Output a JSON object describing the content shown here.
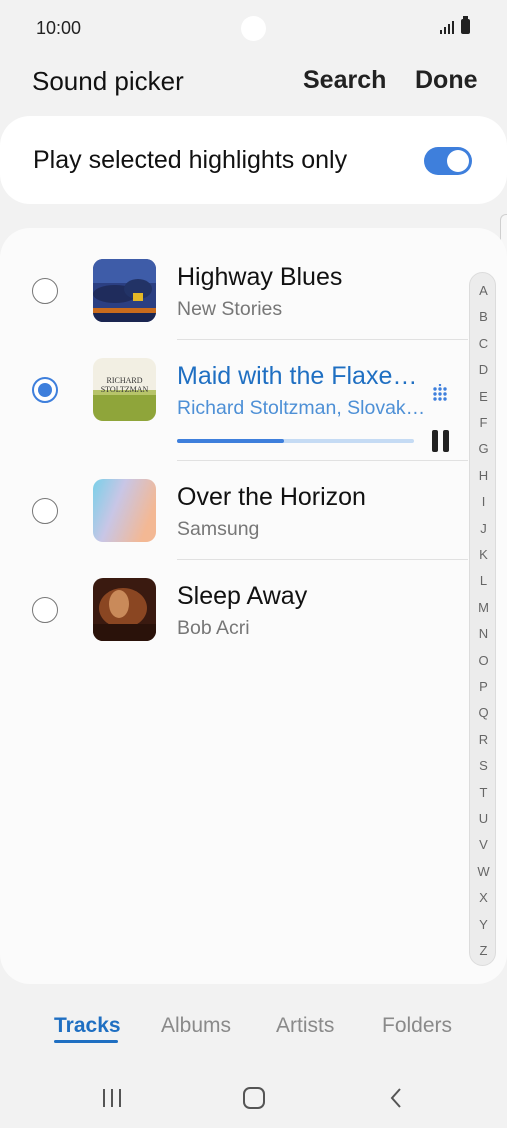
{
  "status_bar": {
    "time": "10:00"
  },
  "header": {
    "title": "Sound picker",
    "search_label": "Search",
    "done_label": "Done"
  },
  "highlights": {
    "label": "Play selected highlights only",
    "enabled": true
  },
  "tracks": [
    {
      "title": "Highway Blues",
      "artist": "New Stories",
      "selected": false
    },
    {
      "title": "Maid with the Flaxe…",
      "artist": "Richard Stoltzman, Slovak…",
      "selected": true,
      "playing": true,
      "progress": 0.45
    },
    {
      "title": "Over the Horizon",
      "artist": "Samsung",
      "selected": false
    },
    {
      "title": "Sleep Away",
      "artist": "Bob Acri",
      "selected": false
    }
  ],
  "album_art_text": {
    "track_2_line1": "RICHARD",
    "track_2_line2": "STOLTZMAN"
  },
  "alphabet_index": [
    "A",
    "B",
    "C",
    "D",
    "E",
    "F",
    "G",
    "H",
    "I",
    "J",
    "K",
    "L",
    "M",
    "N",
    "O",
    "P",
    "Q",
    "R",
    "S",
    "T",
    "U",
    "V",
    "W",
    "X",
    "Y",
    "Z"
  ],
  "tabs": [
    {
      "label": "Tracks",
      "active": true
    },
    {
      "label": "Albums",
      "active": false
    },
    {
      "label": "Artists",
      "active": false
    },
    {
      "label": "Folders",
      "active": false
    }
  ],
  "nav_bar": {
    "icons": [
      "recent-apps-icon",
      "home-icon",
      "back-icon"
    ]
  },
  "colors": {
    "accent": "#3e7fdc",
    "playing_title": "#1f6fc2"
  }
}
